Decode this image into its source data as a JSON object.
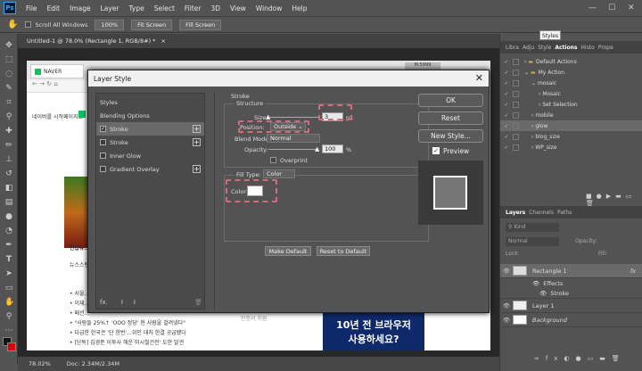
{
  "menubar": {
    "logo": "Ps",
    "items": [
      "File",
      "Edit",
      "Image",
      "Layer",
      "Type",
      "Select",
      "Filter",
      "3D",
      "View",
      "Window",
      "Help"
    ],
    "win_controls": [
      "—",
      "☐",
      "✕"
    ]
  },
  "options_bar": {
    "scroll_all_label": "Scroll All Windows",
    "zoom_label": "100%",
    "fit_label": "Fit Screen",
    "fill_label": "Fill Screen"
  },
  "document": {
    "tab_title": "Untitled-1 @ 78.0% (Rectangle 1, RGB/8#) *",
    "close": "×"
  },
  "browser": {
    "tab_label": "NAVER",
    "hint_text": "네이버를 시작페이지로",
    "news_title": "연합뉴스",
    "news_subtitle": "뉴스스탠드",
    "headlines": [
      "• 서울...",
      "• 이재...",
      "• 패션...",
      "• \"사람들 25%↑ 'OOO 정당' 현 사람을 걸려냈다\"",
      "• 다급한 한국은 '단 한번'...위인 대처 한결 공급됐다",
      "• [단독] 김경준 이투사 해운 미시철건전' 도한 발견"
    ],
    "ad_line1": "10년 전 브라우저",
    "ad_line2": "사용하세요?",
    "ad_caption": "인증서 지원",
    "mini_label": "M:5999"
  },
  "status_bar": {
    "zoom": "78.02%",
    "doc_info": "Doc: 2.34M/2.34M"
  },
  "dialog": {
    "title": "Layer Style",
    "close": "✕",
    "styles_list": [
      {
        "label": "Styles",
        "checkbox": false,
        "checked": false,
        "plus": false,
        "selected": false
      },
      {
        "label": "Blending Options",
        "checkbox": false,
        "checked": false,
        "plus": false,
        "selected": false
      },
      {
        "label": "Stroke",
        "checkbox": true,
        "checked": true,
        "plus": true,
        "selected": true
      },
      {
        "label": "Stroke",
        "checkbox": true,
        "checked": false,
        "plus": true,
        "selected": false
      },
      {
        "label": "Inner Glow",
        "checkbox": true,
        "checked": false,
        "plus": false,
        "selected": false
      },
      {
        "label": "Gradient Overlay",
        "checkbox": true,
        "checked": false,
        "plus": true,
        "selected": false
      }
    ],
    "list_footer": {
      "fx": "fx.",
      "up": "⬆",
      "down": "⬇",
      "trash": "🗑"
    },
    "stroke": {
      "section_title": "Stroke",
      "structure_title": "Structure",
      "size_label": "Size:",
      "size_value": "3",
      "size_unit": "px",
      "position_label": "Position:",
      "position_value": "Outside",
      "blend_label": "Blend Mode:",
      "blend_value": "Normal",
      "opacity_label": "Opacity:",
      "opacity_value": "100",
      "opacity_unit": "%",
      "overprint_label": "Overprint",
      "fill_type_label": "Fill Type:",
      "fill_type_value": "Color",
      "color_label": "Color:",
      "color_value": "#ffffff"
    },
    "make_default": "Make Default",
    "reset_default": "Reset to Default",
    "buttons": {
      "ok": "OK",
      "reset": "Reset",
      "new_style": "New Style...",
      "preview": "Preview"
    },
    "highlight_color": "#d6697e"
  },
  "right_panel": {
    "styles_tooltip": "Styles",
    "actions_tabs": [
      "Libra",
      "Adju",
      "Style",
      "Actions",
      "Histo",
      "Prope"
    ],
    "actions": [
      {
        "label": "Default Actions",
        "indent": 0,
        "kind": "folder",
        "expanded": false
      },
      {
        "label": "My Action",
        "indent": 0,
        "kind": "folder",
        "expanded": true
      },
      {
        "label": "mosaic",
        "indent": 1,
        "kind": "action",
        "expanded": true
      },
      {
        "label": "Mosaic",
        "indent": 2,
        "kind": "step",
        "expanded": false
      },
      {
        "label": "Set Selection",
        "indent": 2,
        "kind": "step",
        "expanded": false
      },
      {
        "label": "mobile",
        "indent": 1,
        "kind": "action",
        "expanded": false
      },
      {
        "label": "glow",
        "indent": 1,
        "kind": "action",
        "expanded": false
      },
      {
        "label": "blog_size",
        "indent": 1,
        "kind": "action",
        "expanded": false
      },
      {
        "label": "WP_size",
        "indent": 1,
        "kind": "action",
        "expanded": false
      }
    ],
    "layers_tabs": [
      "Layers",
      "Channels",
      "Paths"
    ],
    "kind_label": "Kind",
    "blend_mode": "Normal",
    "opacity_label": "Opacity:",
    "fill_label": "Fill:",
    "lock_label": "Lock:",
    "layers": [
      {
        "label": "Rectangle 1",
        "fx": "fx",
        "selected": true,
        "italic": false
      },
      {
        "label": "Effects",
        "fx": "",
        "selected": false,
        "italic": false
      },
      {
        "label": "Stroke",
        "fx": "",
        "selected": false,
        "italic": false
      },
      {
        "label": "Layer 1",
        "fx": "",
        "selected": false,
        "italic": false
      },
      {
        "label": "Background",
        "fx": "",
        "selected": false,
        "italic": true
      }
    ]
  }
}
